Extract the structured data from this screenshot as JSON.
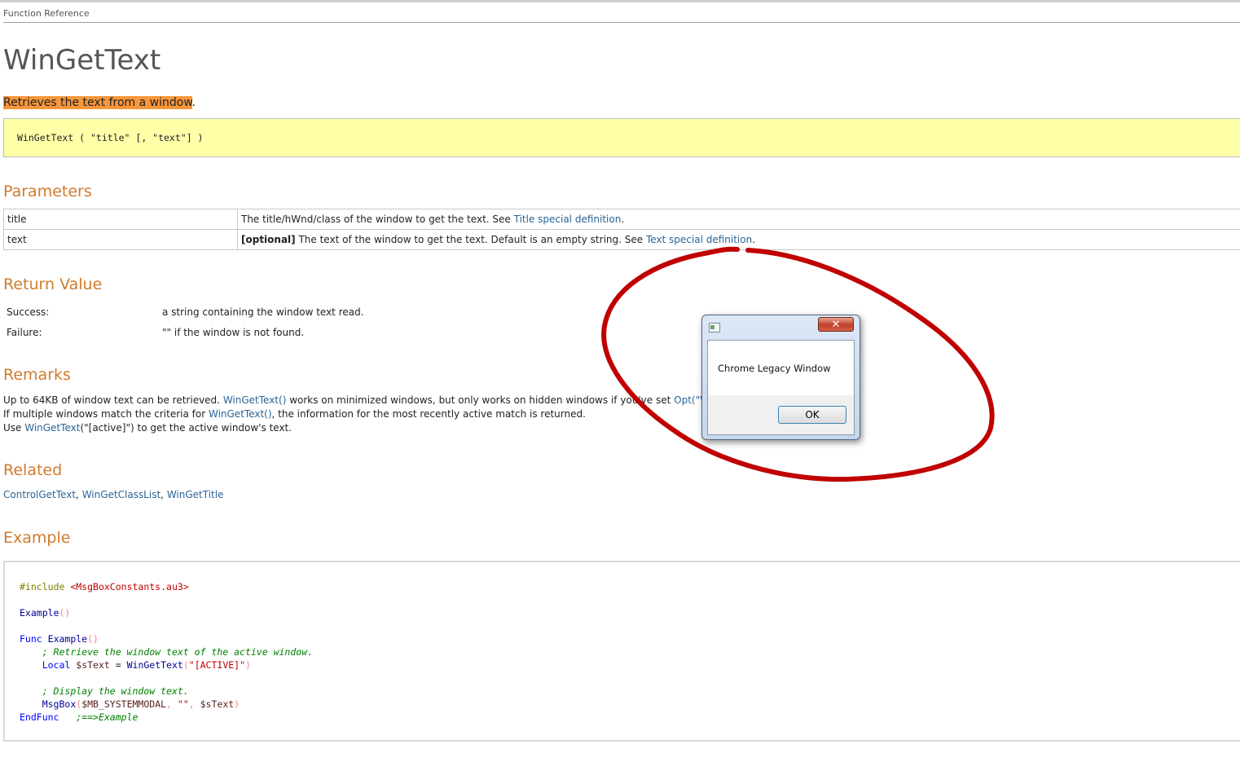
{
  "breadcrumb": "Function Reference",
  "title": "WinGetText",
  "description": {
    "highlighted": "Retrieves the text from a window",
    "tail": "."
  },
  "syntax": "WinGetText ( \"title\" [, \"text\"] )",
  "sections": {
    "parameters": "Parameters",
    "return_value": "Return Value",
    "remarks": "Remarks",
    "related": "Related",
    "example": "Example"
  },
  "parameters": [
    {
      "name": "title",
      "desc_pre": "The title/hWnd/class of the window to get the text. See ",
      "link": "Title special definition",
      "desc_post": "."
    },
    {
      "name": "text",
      "optional": "[optional]",
      "desc_pre": " The text of the window to get the text. Default is an empty string. See ",
      "link": "Text special definition",
      "desc_post": "."
    }
  ],
  "return_value": {
    "success_label": "Success:",
    "success_text": "a string containing the window text read.",
    "failure_label": "Failure:",
    "failure_text": "\"\" if the window is not found."
  },
  "remarks": {
    "line1_pre": "Up to 64KB of window text can be retrieved. ",
    "line1_link": "WinGetText()",
    "line1_mid": " works on minimized windows, but only works on hidden windows if you've set ",
    "line1_link2": "Opt(\"WinDet",
    "line2_pre": "If multiple windows match the criteria for ",
    "line2_link": "WinGetText()",
    "line2_post": ", the information for the most recently active match is returned.",
    "line3_pre": "Use ",
    "line3_link": "WinGetText",
    "line3_post": "(\"[active]\") to get the active window's text."
  },
  "related": {
    "links": [
      "ControlGetText",
      "WinGetClassList",
      "WinGetTitle"
    ],
    "sep": ", "
  },
  "example_code": {
    "include": "#include",
    "include_file": "<MsgBoxConstants.au3>",
    "call": "Example",
    "func_kw": "Func",
    "func_name": "Example",
    "comment1": "; Retrieve the window text of the active window.",
    "local_kw": "Local",
    "var": "$sText",
    "eq": " = ",
    "wingettext": "WinGetText",
    "active_str": "\"[ACTIVE]\"",
    "comment2": "; Display the window text.",
    "msgbox": "MsgBox",
    "msgbox_const": "$MB_SYSTEMMODAL",
    "empty_str": "\"\"",
    "endfunc_kw": "EndFunc",
    "endfunc_comment": ";==>Example"
  },
  "dialog": {
    "message": "Chrome Legacy Window",
    "ok_label": "OK",
    "close_glyph": "✕"
  },
  "colors": {
    "heading": "#d07a2c",
    "link": "#2a6496",
    "highlight": "#f7963a",
    "syntax_bg": "#ffffa8",
    "annotation": "#c00000"
  }
}
